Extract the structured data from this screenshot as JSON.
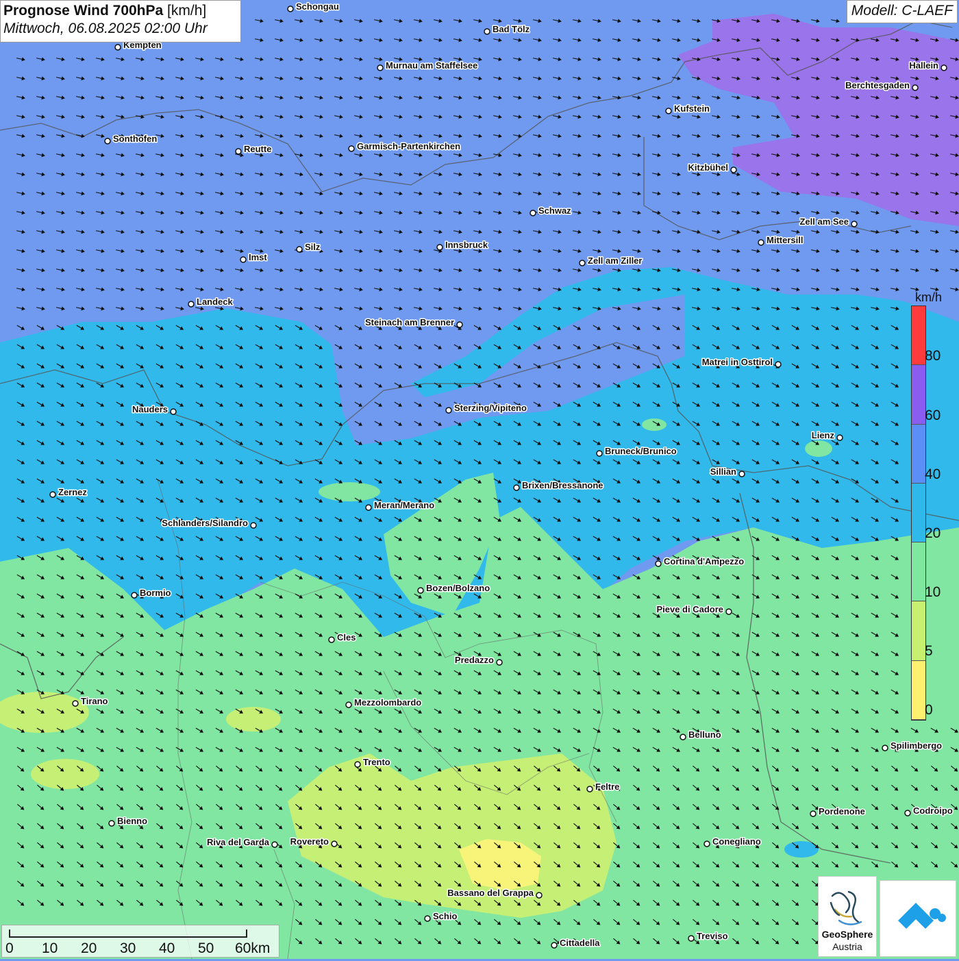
{
  "title": {
    "main": "Prognose Wind 700hPa",
    "unit": "[km/h]",
    "datetime": "Mittwoch, 06.08.2025 02:00 Uhr"
  },
  "model": "Modell: C-LAEF",
  "legend": {
    "unit": "km/h",
    "ticks": [
      "80",
      "60",
      "40",
      "20",
      "10",
      "5",
      "0"
    ],
    "colors": [
      "#ff3b3b",
      "#8a5cf0",
      "#5b8ff5",
      "#2fb8ea",
      "#7ee8a0",
      "#c8f070",
      "#fff070"
    ]
  },
  "scalebar": {
    "labels": [
      "0",
      "10",
      "20",
      "30",
      "40",
      "50",
      "60km"
    ]
  },
  "logos": {
    "geosphere_line1": "GeoSphere",
    "geosphere_line2": "Austria"
  },
  "cities": [
    {
      "name": "Schongau"
    },
    {
      "name": "Bad Tölz"
    },
    {
      "name": "Kempten"
    },
    {
      "name": "Murnau am Staffelsee"
    },
    {
      "name": "Hallein"
    },
    {
      "name": "Berchtesgaden"
    },
    {
      "name": "Kufstein"
    },
    {
      "name": "Sonthofen"
    },
    {
      "name": "Reutte"
    },
    {
      "name": "Garmisch-Partenkirchen"
    },
    {
      "name": "Kitzbühel"
    },
    {
      "name": "Schwaz"
    },
    {
      "name": "Zell am See"
    },
    {
      "name": "Mittersill"
    },
    {
      "name": "Silz"
    },
    {
      "name": "Innsbruck"
    },
    {
      "name": "Imst"
    },
    {
      "name": "Zell am Ziller"
    },
    {
      "name": "Landeck"
    },
    {
      "name": "Steinach am Brenner"
    },
    {
      "name": "Matrei in Osttirol"
    },
    {
      "name": "Nauders"
    },
    {
      "name": "Sterzing/Vipiteno"
    },
    {
      "name": "Lienz"
    },
    {
      "name": "Bruneck/Brunico"
    },
    {
      "name": "Sillian"
    },
    {
      "name": "Brixen/Bressanone"
    },
    {
      "name": "Zernez"
    },
    {
      "name": "Meran/Merano"
    },
    {
      "name": "Schlanders/Silandro"
    },
    {
      "name": "Cortina d'Ampezzo"
    },
    {
      "name": "Bozen/Bolzano"
    },
    {
      "name": "Bormio"
    },
    {
      "name": "Pieve di Cadore"
    },
    {
      "name": "Cles"
    },
    {
      "name": "Predazzo"
    },
    {
      "name": "Tirano"
    },
    {
      "name": "Mezzolombardo"
    },
    {
      "name": "Belluno"
    },
    {
      "name": "Spilimbergo"
    },
    {
      "name": "Trento"
    },
    {
      "name": "Feltre"
    },
    {
      "name": "Bienno"
    },
    {
      "name": "Pordenone"
    },
    {
      "name": "Codroipo"
    },
    {
      "name": "Riva del Garda"
    },
    {
      "name": "Rovereto"
    },
    {
      "name": "Conegliano"
    },
    {
      "name": "Bassano del Grappa"
    },
    {
      "name": "Schio"
    },
    {
      "name": "Treviso"
    },
    {
      "name": "Cittadella"
    }
  ]
}
